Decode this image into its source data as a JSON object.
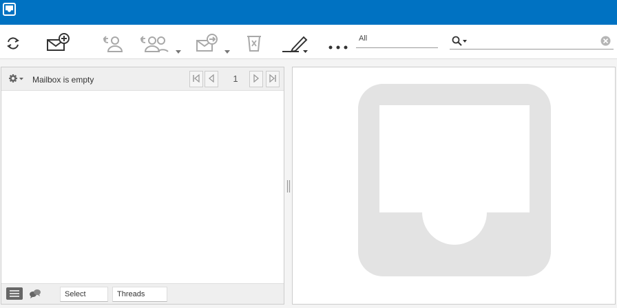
{
  "toolbar": {
    "filter_value": "All",
    "search_value": ""
  },
  "message_list": {
    "status_text": "Mailbox is empty",
    "page_number": "1"
  },
  "list_footer": {
    "select_label": "Select",
    "threads_label": "Threads"
  },
  "colors": {
    "header_bg": "#0072c2",
    "icon_dark": "#333333",
    "icon_disabled": "#a8a8a8",
    "watermark": "#e3e3e3"
  },
  "icons": [
    "app-logo-icon",
    "refresh-icon",
    "compose-icon",
    "reply-icon",
    "reply-all-icon",
    "forward-icon",
    "delete-icon",
    "mark-icon",
    "more-icon",
    "search-icon",
    "clear-icon",
    "gear-icon",
    "first-page-icon",
    "prev-page-icon",
    "next-page-icon",
    "last-page-icon",
    "list-view-icon",
    "threads-view-icon",
    "mailbox-empty-icon"
  ]
}
